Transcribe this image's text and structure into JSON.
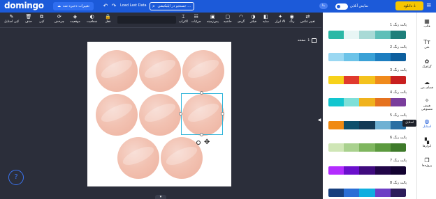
{
  "topbar": {
    "logo": "domingo",
    "save_status": "تغییرات ذخیره شد",
    "load_last": "Load Last Data",
    "search_placeholder": "جستجو در اپلیکیشن ...",
    "beta_tag": "بتا",
    "preview_label": "نمایش آنلاین",
    "download_label": "دانلود",
    "undo_icon": "↶",
    "redo_icon": "↷",
    "menu_icon": "≡"
  },
  "toolbar": {
    "items": [
      {
        "label": "کپی استایل",
        "icon": "✎"
      },
      {
        "label": "حذف",
        "icon": "🗑"
      },
      {
        "label": "کپی",
        "icon": "⧉"
      },
      {
        "label": "چرخش",
        "icon": "⟳"
      },
      {
        "label": "موقعیت",
        "icon": "◈"
      },
      {
        "label": "شفافیت",
        "icon": "◐"
      },
      {
        "label": "قفل",
        "icon": "🔒"
      },
      {
        "label": "اکتراپ",
        "icon": "⌶"
      },
      {
        "label": "جزئیات",
        "icon": "☷"
      },
      {
        "label": "پس‌زمینه",
        "icon": "▣"
      },
      {
        "label": "حاشیه",
        "icon": "▢"
      },
      {
        "label": "گردی",
        "icon": "◠"
      },
      {
        "label": "فیلتر",
        "icon": "◑"
      },
      {
        "label": "سایه",
        "icon": "◧"
      },
      {
        "label": "ابزار AI",
        "icon": "✦"
      },
      {
        "label": "رنگ",
        "icon": "◉"
      },
      {
        "label": "تغییر عکس",
        "icon": "⇄"
      }
    ]
  },
  "workspace": {
    "page_label": "صفحه",
    "page_number": "1"
  },
  "help_icon": "?",
  "palettes": [
    {
      "title": "پالت رنگ 1",
      "colors": [
        "#2bb8a6",
        "#e8f6f5",
        "#a9dad6",
        "#5fbfb8",
        "#1e7f7a"
      ]
    },
    {
      "title": "پالت رنگ 2",
      "colors": [
        "#9bd8f2",
        "#6cc3e8",
        "#3aa1d6",
        "#1d7ec0",
        "#0d5f9e"
      ]
    },
    {
      "title": "پالت رنگ 3",
      "colors": [
        "#f7d21a",
        "#e03a2e",
        "#f4c21d",
        "#f08a1c",
        "#c81f1f"
      ]
    },
    {
      "title": "پالت رنگ 4",
      "colors": [
        "#12c6cf",
        "#7ee0d8",
        "#f0b21d",
        "#e5721f",
        "#7a3d9c"
      ]
    },
    {
      "title": "پالت رنگ 5",
      "colors": [
        "#f08a12",
        "#0f4f6b",
        "#143a55",
        "#6fb1d3",
        "#2a6fa3"
      ]
    },
    {
      "title": "پالت رنگ 6",
      "colors": [
        "#cfe6b6",
        "#a9d18e",
        "#7fb65f",
        "#5c9a3f",
        "#3e7a2a"
      ]
    },
    {
      "title": "پالت رنگ 7",
      "colors": [
        "#b32cff",
        "#6a0fcc",
        "#3f0a7e",
        "#210548",
        "#120230"
      ]
    },
    {
      "title": "پالت رنگ 8",
      "colors": [
        "#173f7e",
        "#2a6fd6",
        "#10aee0",
        "#6d3fc5",
        "#2c1c5a"
      ]
    }
  ],
  "tooltip": "استایل",
  "sidebar": {
    "items": [
      {
        "label": "قالب",
        "icon": "▦"
      },
      {
        "label": "متن",
        "icon": "Tт"
      },
      {
        "label": "گرافیک",
        "icon": "✿"
      },
      {
        "label": "فضای من",
        "icon": "☁"
      },
      {
        "label": "هوش مصنوعی",
        "icon": "✧"
      },
      {
        "label": "استایل",
        "icon": "◍"
      },
      {
        "label": "ابزارها",
        "icon": "▚"
      },
      {
        "label": "پروژه‌ها",
        "icon": "❐"
      }
    ]
  }
}
